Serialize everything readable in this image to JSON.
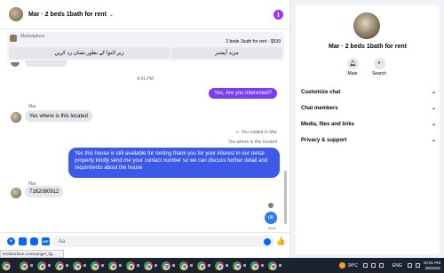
{
  "header": {
    "title": "Mar · 2 beds 1bath for rent",
    "chevron": "⌄",
    "info_icon": "i"
  },
  "marketplace": {
    "label": "Marketplace",
    "listing_title": "2 beds 1bath for rent - $539",
    "button_more": "مزید آپشنز",
    "button_send": "زیر التوا کے بطور نشان زد کریں"
  },
  "messages": {
    "timestamp": "9:41 PM",
    "out1": "Yes, Are you interested?",
    "sender1": "Mar",
    "in1": "Yes where is this located",
    "reply_note": "You replied to Mar",
    "quoted_text": "Yes where is this located",
    "out2": "Yes this house is still available for renting thank you for your interest in our rental property kindly send me your contact number so we can discuss further detail and requirments about the house",
    "sender2": "Mar",
    "in2": "7162080912",
    "out3": "ok",
    "status": "Sent"
  },
  "composer": {
    "placeholder": "Aa",
    "like_icon": "👍"
  },
  "status_url": "teralSurface=messenger_lig...",
  "right_panel": {
    "title": "Mar · 2 beds 1bath for rent",
    "actions": [
      {
        "label": "Mute",
        "icon": "bell-icon"
      },
      {
        "label": "Search",
        "icon": "search-icon"
      }
    ],
    "sections": [
      {
        "label": "Customize chat"
      },
      {
        "label": "Chat members"
      },
      {
        "label": "Media, files and links"
      },
      {
        "label": "Privacy & support"
      }
    ]
  },
  "taskbar": {
    "temperature": "34°C",
    "language": "ENG",
    "time": "10:01 PM",
    "date": "3/8/2025"
  },
  "colors": {
    "outgoing": "#3b5ae8",
    "accent": "#0866ff",
    "info": "#a033ff"
  }
}
